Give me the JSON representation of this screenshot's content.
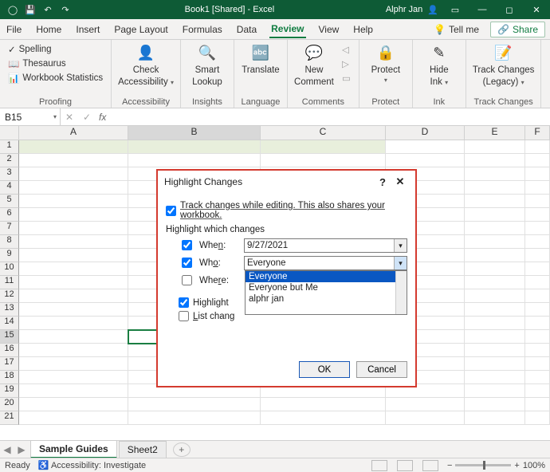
{
  "titlebar": {
    "title": "Book1 [Shared] - Excel",
    "user": "Alphr Jan"
  },
  "tabs": {
    "items": [
      "File",
      "Home",
      "Insert",
      "Page Layout",
      "Formulas",
      "Data",
      "Review",
      "View",
      "Help"
    ],
    "active": "Review",
    "tellme": "Tell me",
    "share": "Share"
  },
  "ribbon": {
    "proofing": {
      "label": "Proofing",
      "spelling": "Spelling",
      "thesaurus": "Thesaurus",
      "stats": "Workbook Statistics"
    },
    "accessibility": {
      "label": "Accessibility",
      "check": "Check",
      "check2": "Accessibility"
    },
    "insights": {
      "label": "Insights",
      "smart": "Smart",
      "lookup": "Lookup"
    },
    "language": {
      "label": "Language",
      "translate": "Translate"
    },
    "comments": {
      "label": "Comments",
      "new": "New",
      "comment": "Comment"
    },
    "protect": {
      "label": "Protect",
      "protect": "Protect"
    },
    "ink": {
      "label": "Ink",
      "hide": "Hide",
      "ink": "Ink"
    },
    "trackchanges": {
      "label": "Track Changes",
      "track": "Track Changes",
      "legacy": "(Legacy)"
    }
  },
  "formula": {
    "namebox": "B15"
  },
  "sheet": {
    "cols": [
      "A",
      "B",
      "C",
      "D",
      "E",
      "F"
    ],
    "rows": [
      "1",
      "2",
      "3",
      "4",
      "5",
      "6",
      "7",
      "8",
      "9",
      "10",
      "11",
      "12",
      "13",
      "14",
      "15",
      "16",
      "17",
      "18",
      "19",
      "20",
      "21"
    ],
    "tab1": "Sample Guides",
    "tab2": "Sheet2"
  },
  "dialog": {
    "title": "Highlight Changes",
    "track_label": "Track changes while editing. This also shares your workbook.",
    "section": "Highlight which changes",
    "when_label": "When:",
    "when_value": "9/27/2021",
    "who_label": "Who:",
    "who_value": "Everyone",
    "where_label": "Where:",
    "highlight_label": "Highlight",
    "list_label": "List chang",
    "options": {
      "o1": "Everyone",
      "o2": "Everyone but Me",
      "o3": "alphr jan"
    },
    "ok": "OK",
    "cancel": "Cancel"
  },
  "status": {
    "ready": "Ready",
    "acc": "Accessibility: Investigate",
    "zoom": "100%"
  }
}
